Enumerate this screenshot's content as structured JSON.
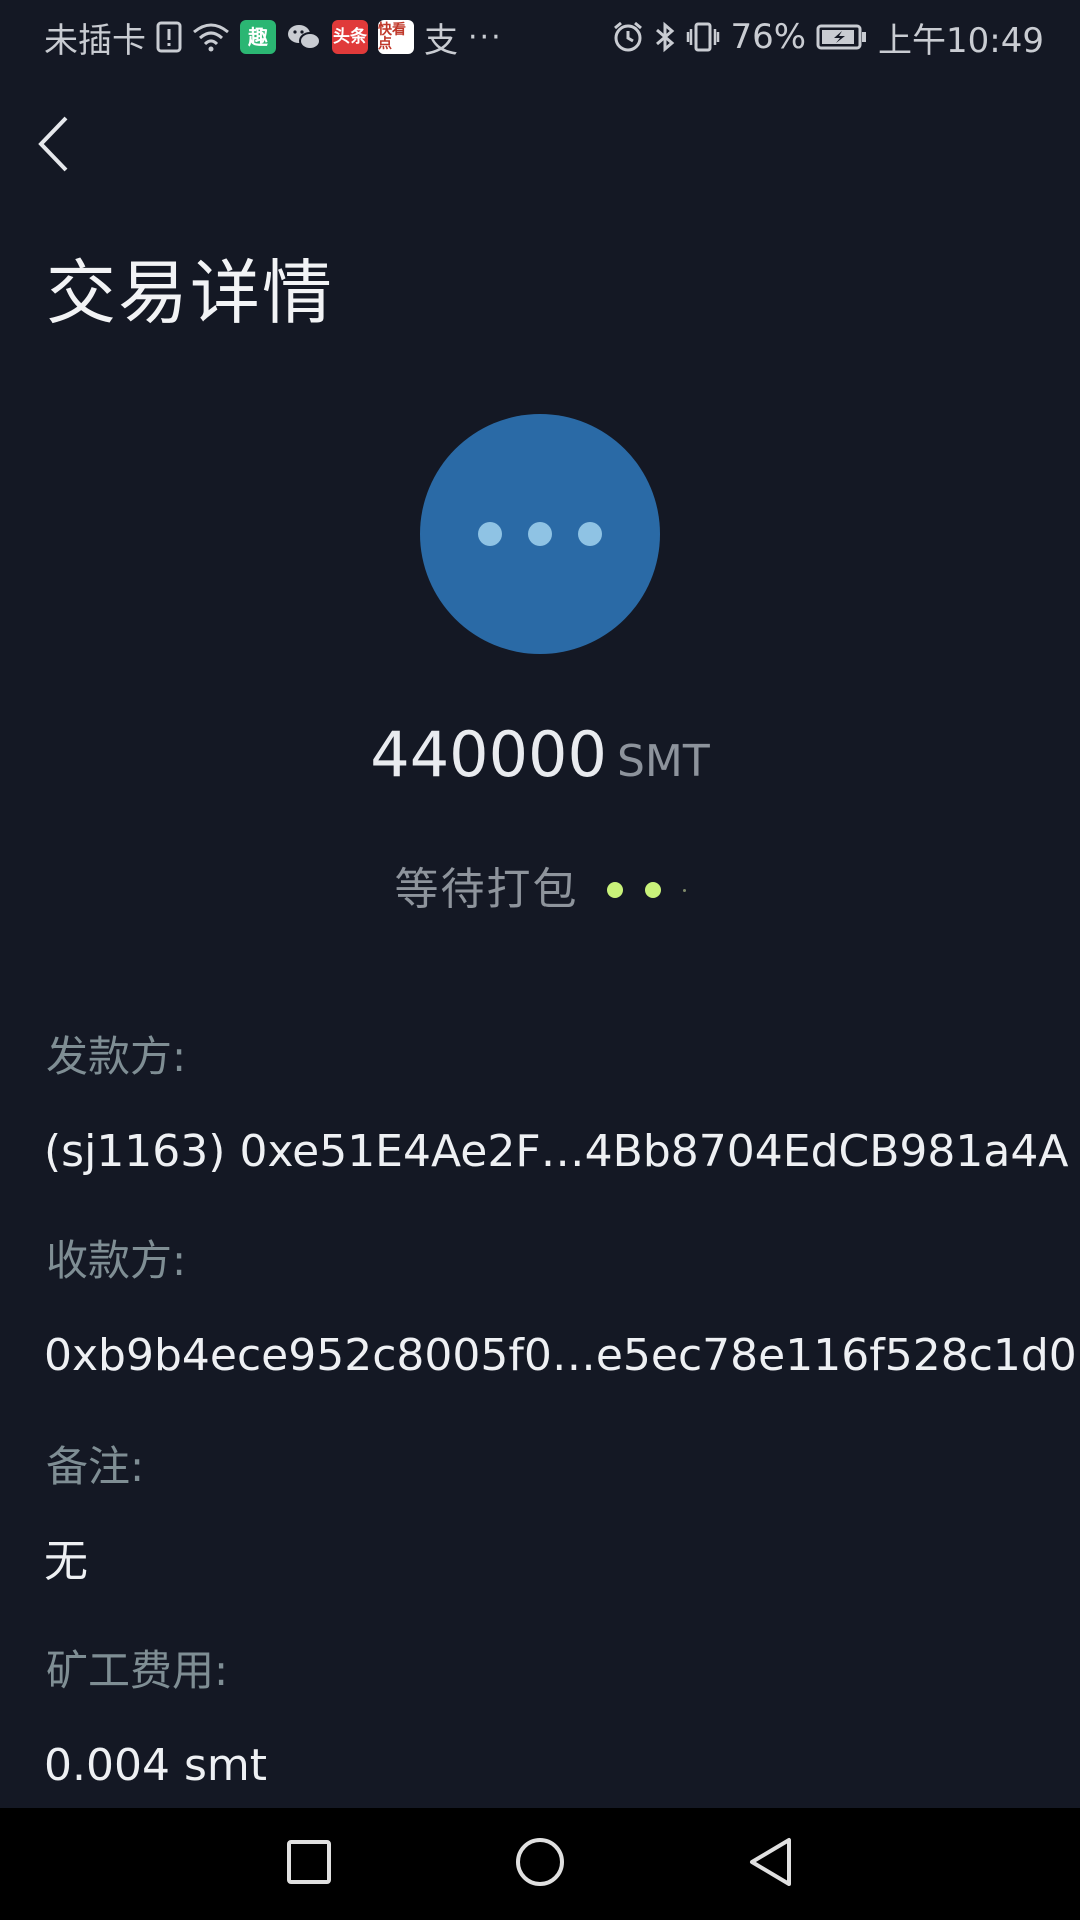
{
  "status_bar": {
    "carrier": "未插卡",
    "app_badges": [
      "趣",
      "头条",
      "快看点"
    ],
    "alipay": "支",
    "more": "···",
    "battery_percent": "76%",
    "time": "上午10:49"
  },
  "header": {
    "title": "交易详情"
  },
  "transaction": {
    "amount": "440000",
    "unit": "SMT",
    "status": "等待打包",
    "circle_color": "#2a6aa6",
    "accent_color": "#c9f27a"
  },
  "details": {
    "sender_label": "发款方:",
    "sender_value": "(sj1163) 0xe51E4Ae2F…4Bb8704EdCB981a4A",
    "receiver_label": "收款方:",
    "receiver_value": "0xb9b4ece952c8005f0…e5ec78e116f528c1d0",
    "memo_label": "备注:",
    "memo_value": "无",
    "fee_label": "矿工费用:",
    "fee_value": "0.004 smt"
  },
  "icons": {
    "back": "chevron-left-icon",
    "nav_recent": "square-icon",
    "nav_home": "circle-icon",
    "nav_back": "triangle-left-icon"
  }
}
